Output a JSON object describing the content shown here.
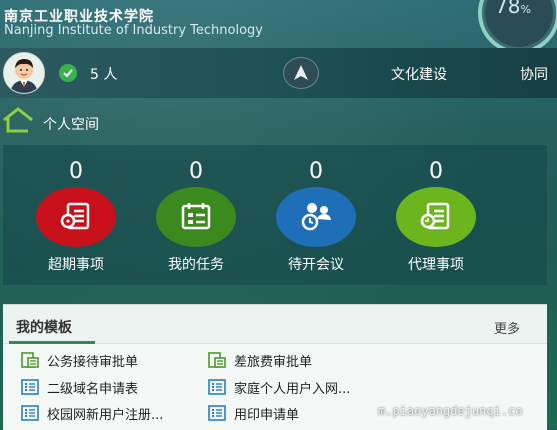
{
  "header": {
    "school_name_cn": "南京工业职业技术学院",
    "school_name_en": "Nanjing Institute of Industry Technology",
    "gauge_value": "78",
    "gauge_unit": "%"
  },
  "navbar": {
    "online_count": "5 人",
    "items": [
      {
        "label": "文化建设"
      },
      {
        "label": "协同"
      }
    ]
  },
  "personal_space": {
    "title": "个人空间"
  },
  "stats": [
    {
      "count": "0",
      "label": "超期事项",
      "color": "#c8101b",
      "icon": "overdue-icon"
    },
    {
      "count": "0",
      "label": "我的任务",
      "color": "#3c8a1e",
      "icon": "task-icon"
    },
    {
      "count": "0",
      "label": "待开会议",
      "color": "#1f6fb8",
      "icon": "meeting-icon"
    },
    {
      "count": "0",
      "label": "代理事项",
      "color": "#6db51f",
      "icon": "proxy-icon"
    }
  ],
  "templates": {
    "title": "我的模板",
    "more": "更多",
    "items": [
      {
        "label": "公务接待审批单",
        "icon": "form-green-icon"
      },
      {
        "label": "差旅费审批单",
        "icon": "form-green-icon"
      },
      {
        "label": "二级域名申请表",
        "icon": "list-blue-icon"
      },
      {
        "label": "家庭个人用户入网...",
        "icon": "list-blue-icon"
      },
      {
        "label": "校园网新用户注册...",
        "icon": "list-blue-icon"
      },
      {
        "label": "用印申请单",
        "icon": "list-blue-icon"
      }
    ]
  },
  "watermark": "m.piaoyangdejunqi.co",
  "colors": {
    "accent_green": "#2f8a5a",
    "online_green": "#37b24d"
  }
}
